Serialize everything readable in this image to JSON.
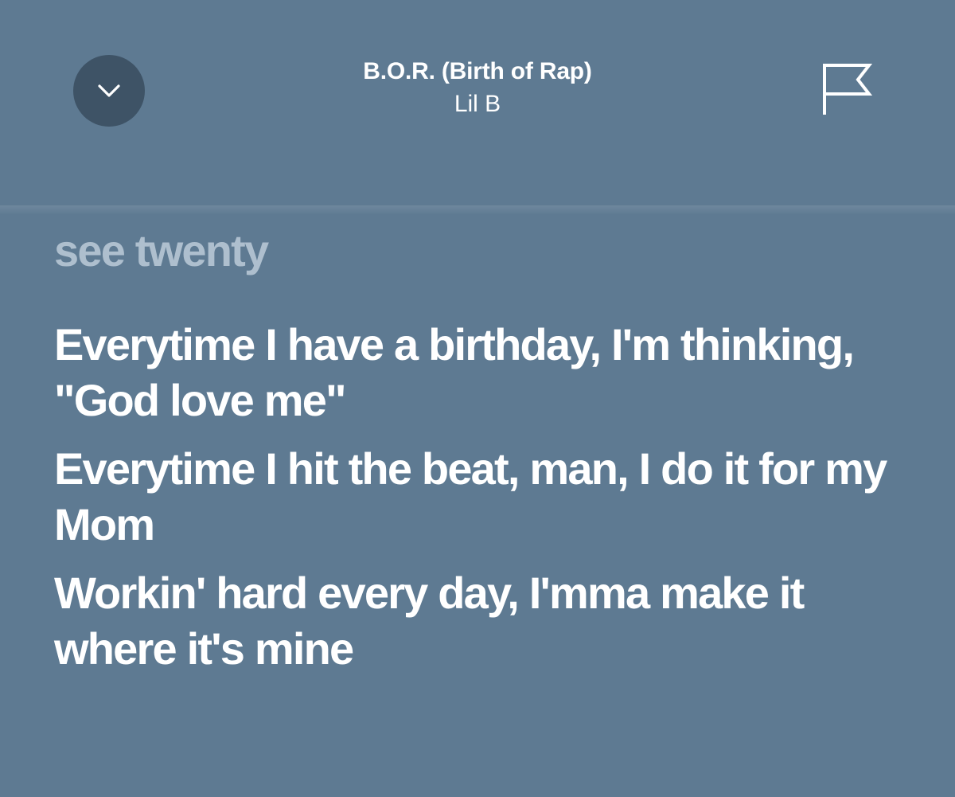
{
  "header": {
    "collapse_icon": "chevron-down-icon",
    "track_title": "B.O.R. (Birth of Rap)",
    "artist": "Lil B",
    "report_icon": "flag-icon"
  },
  "lyrics": {
    "past_line": "see twenty",
    "lines": [
      "Everytime I have a birthday, I'm thinking, \"God love me\"",
      "Everytime I hit the beat, man, I do it for my Mom",
      "Workin' hard every day, I'mma make it where it's mine"
    ]
  },
  "colors": {
    "background": "#5e7a92",
    "button_background": "#3e5366",
    "text_primary": "#ffffff",
    "text_past": "#bdccd9"
  }
}
